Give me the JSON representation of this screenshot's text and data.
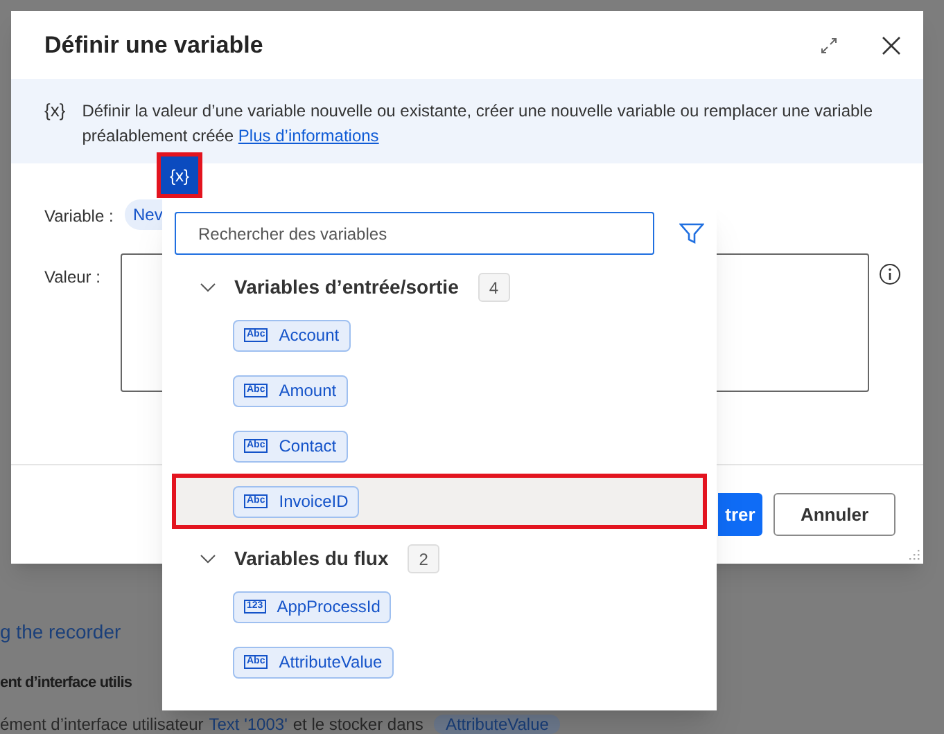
{
  "background_page": {
    "recorder_link": "g the recorder",
    "action_title": "ent d’interface utilis",
    "action_description": "ément d’interface utilisateur",
    "action_value": "Text '1003'",
    "action_middle": "et le stocker dans",
    "action_variable": "AttributeValue"
  },
  "dialog": {
    "title": "Définir une variable",
    "info_icon_text": "{x}",
    "info_text": "Définir la valeur d’une variable nouvelle ou existante, créer une nouvelle variable ou remplacer une variable préalablement créée",
    "info_link": "Plus d’informations",
    "variable_label": "Variable :",
    "variable_chip": "Nev",
    "value_label": "Valeur :",
    "variable_picker_button": "{x}",
    "buttons": [
      {
        "label": "trer",
        "kind": "primary"
      },
      {
        "label": "Annuler",
        "kind": "secondary"
      }
    ]
  },
  "variable_picker": {
    "search": {
      "placeholder": "Rechercher des variables"
    },
    "groups": [
      {
        "title": "Variables d’entrée/sortie",
        "count": "4",
        "expanded": true,
        "items": [
          {
            "name": "Account",
            "type_label": "Abc",
            "selected": false
          },
          {
            "name": "Amount",
            "type_label": "Abc",
            "selected": false
          },
          {
            "name": "Contact",
            "type_label": "Abc",
            "selected": false
          },
          {
            "name": "InvoiceID",
            "type_label": "Abc",
            "selected": true
          }
        ]
      },
      {
        "title": "Variables du flux",
        "count": "2",
        "expanded": true,
        "items": [
          {
            "name": "AppProcessId",
            "type_label": "123",
            "selected": false
          },
          {
            "name": "AttributeValue",
            "type_label": "Abc",
            "selected": false
          }
        ]
      }
    ]
  }
}
